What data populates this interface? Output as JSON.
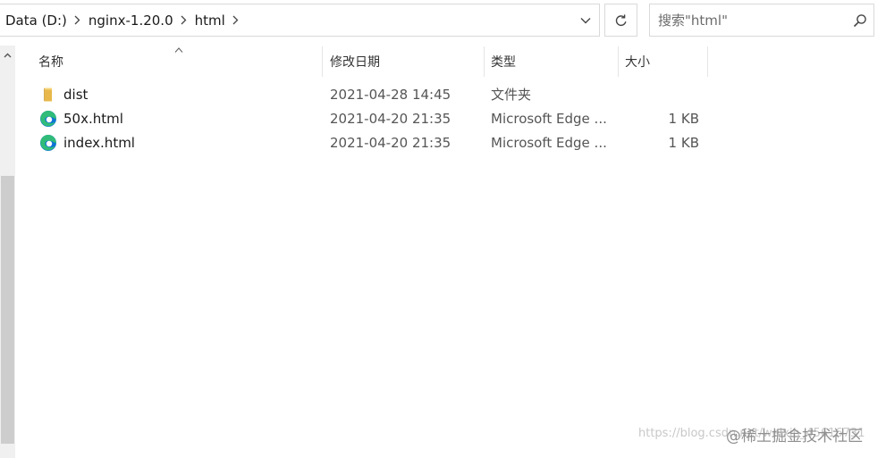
{
  "breadcrumb": {
    "items": [
      "Data (D:)",
      "nginx-1.20.0",
      "html"
    ]
  },
  "search": {
    "placeholder": "搜索\"html\""
  },
  "columns": {
    "name": "名称",
    "date": "修改日期",
    "type": "类型",
    "size": "大小"
  },
  "files": [
    {
      "name": "dist",
      "date": "2021-04-28 14:45",
      "type": "文件夹",
      "size": "",
      "icon": "folder-icon"
    },
    {
      "name": "50x.html",
      "date": "2021-04-20 21:35",
      "type": "Microsoft Edge ...",
      "size": "1 KB",
      "icon": "edge-icon"
    },
    {
      "name": "index.html",
      "date": "2021-04-20 21:35",
      "type": "Microsoft Edge ...",
      "size": "1 KB",
      "icon": "edge-icon"
    }
  ],
  "watermark": {
    "url": "https://blog.csdn.net/weixin_45616731",
    "logo": "@稀土掘金技术社区"
  },
  "colors": {
    "folder": "#e8b84a",
    "edge_blue": "#0c74d4",
    "edge_green": "#34c46e",
    "border": "#d9d9d9"
  }
}
